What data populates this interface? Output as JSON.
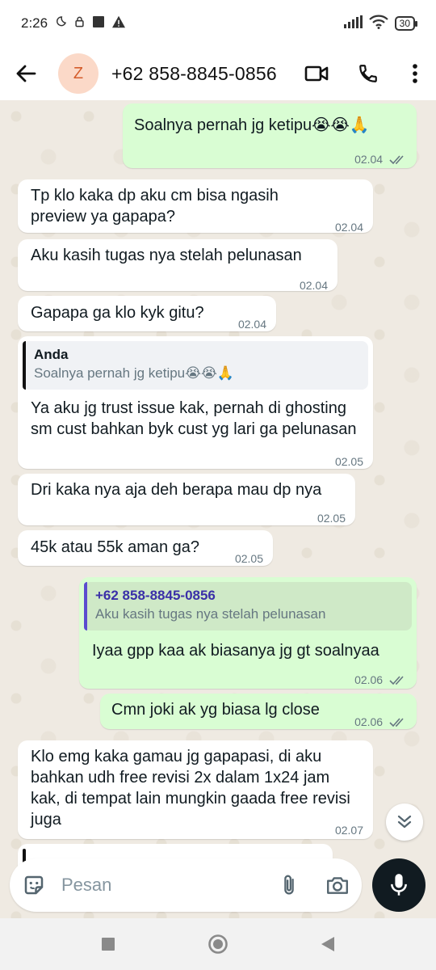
{
  "status_bar": {
    "time": "2:26",
    "battery": "30"
  },
  "header": {
    "avatar_letter": "Z",
    "contact": "+62 858-8845-0856"
  },
  "messages": [
    {
      "dir": "out",
      "text": "Soalnya pernah jg ketipu😭😭🙏",
      "time": "02.04"
    },
    {
      "dir": "in",
      "text": "Tp klo kaka dp aku cm bisa ngasih preview ya gapapa?",
      "time": "02.04"
    },
    {
      "dir": "in",
      "text": "Aku kasih tugas nya stelah pelunasan",
      "time": "02.04"
    },
    {
      "dir": "in",
      "text": "Gapapa ga klo kyk gitu?",
      "time": "02.04"
    },
    {
      "dir": "in",
      "quote_name": "Anda",
      "quote_text": "Soalnya pernah jg ketipu😭😭🙏",
      "text": "Ya aku jg trust issue kak, pernah di ghosting sm cust bahkan byk cust yg lari ga pelunasan",
      "time": "02.05"
    },
    {
      "dir": "in",
      "text": "Dri kaka nya aja deh berapa mau dp nya",
      "time": "02.05"
    },
    {
      "dir": "in",
      "text": "45k atau 55k aman ga?",
      "time": "02.05"
    },
    {
      "dir": "out",
      "quote_name": "+62 858-8845-0856",
      "quote_text": "Aku kasih tugas nya stelah pelunasan",
      "text": "Iyaa gpp kaa ak biasanya jg gt soalnyaa",
      "time": "02.06"
    },
    {
      "dir": "out",
      "text": "Cmn joki ak yg biasa lg close",
      "time": "02.06"
    },
    {
      "dir": "in",
      "text": "Klo emg kaka gamau jg gapapasi, di aku bahkan udh free revisi 2x dalam 1x24 jam kak, di tempat lain mungkin gaada free revisi juga",
      "time": "02.07"
    }
  ],
  "composer": {
    "placeholder": "Pesan"
  }
}
